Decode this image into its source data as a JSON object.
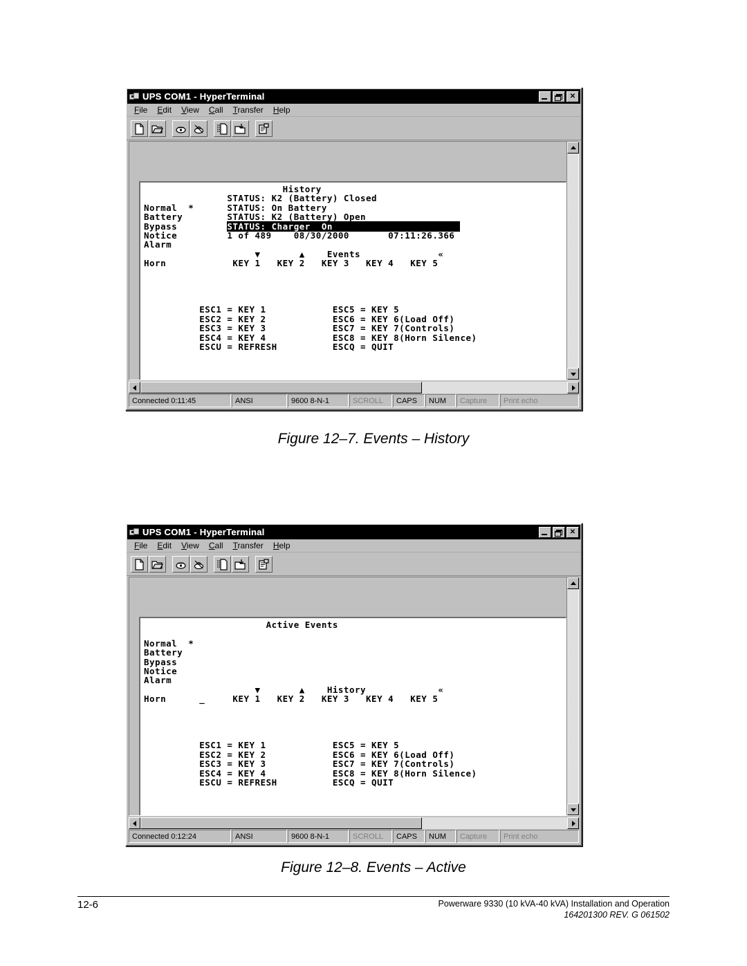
{
  "document": {
    "footer": {
      "page_number": "12-6",
      "product_line": "Powerware 9330 (10 kVA-40 kVA) Installation and Operation",
      "doc_ref": "164201300 REV. G  061502"
    },
    "captions": {
      "figure_12_7": "Figure 12–7. Events – History",
      "figure_12_8": "Figure 12–8. Events – Active"
    }
  },
  "window": {
    "title": "UPS COM1 - HyperTerminal",
    "title_icon": "hyperterminal-icon",
    "controls": {
      "minimize": "_",
      "restore": "❐",
      "close": "✕"
    },
    "menu": [
      {
        "label": "File",
        "accel": "F"
      },
      {
        "label": "Edit",
        "accel": "E"
      },
      {
        "label": "View",
        "accel": "V"
      },
      {
        "label": "Call",
        "accel": "C"
      },
      {
        "label": "Transfer",
        "accel": "T"
      },
      {
        "label": "Help",
        "accel": "H"
      }
    ],
    "toolbar": [
      {
        "name": "new-connection-icon",
        "group": 1
      },
      {
        "name": "open-file-icon",
        "group": 1
      },
      {
        "name": "call-icon",
        "group": 2
      },
      {
        "name": "disconnect-icon",
        "group": 2
      },
      {
        "name": "send-file-icon",
        "group": 3
      },
      {
        "name": "receive-file-icon",
        "group": 3
      },
      {
        "name": "properties-icon",
        "group": 4
      }
    ]
  },
  "terminal_1": {
    "screen_title": "History",
    "lines": [
      {
        "text": "                         History",
        "invert": false
      },
      {
        "text": "               STATUS: K2 (Battery) Closed",
        "invert": false
      },
      {
        "text": "Normal  *      STATUS: On Battery",
        "invert": false
      },
      {
        "text": "Battery        STATUS: K2 (Battery) Open",
        "invert": false
      },
      {
        "text": "Bypass         ",
        "invert": false,
        "highlight": "STATUS: Charger  On                       "
      },
      {
        "text": "Notice         1 of 489    08/30/2000       07:11:26.366",
        "invert": false
      },
      {
        "text": "Alarm",
        "invert": false
      },
      {
        "text": "                    ▼       ▲    Events              «",
        "invert": false
      },
      {
        "text": "Horn            KEY 1   KEY 2   KEY 3   KEY 4   KEY 5",
        "invert": false
      },
      {
        "text": "",
        "invert": false
      },
      {
        "text": "",
        "invert": false
      },
      {
        "text": "",
        "invert": false
      },
      {
        "text": "",
        "invert": false
      },
      {
        "text": "          ESC1 = KEY 1            ESC5 = KEY 5",
        "invert": false
      },
      {
        "text": "          ESC2 = KEY 2            ESC6 = KEY 6(Load Off)",
        "invert": false
      },
      {
        "text": "          ESC3 = KEY 3            ESC7 = KEY 7(Controls)",
        "invert": false
      },
      {
        "text": "          ESC4 = KEY 4            ESC8 = KEY 8(Horn Silence)",
        "invert": false
      },
      {
        "text": "          ESCU = REFRESH          ESCQ = QUIT",
        "invert": false
      }
    ],
    "status": {
      "connected": "Connected 0:11:45",
      "emulation": "ANSI",
      "line_settings": "9600 8-N-1",
      "scroll": "SCROLL",
      "caps": "CAPS",
      "num": "NUM",
      "capture": "Capture",
      "print_echo": "Print echo"
    }
  },
  "terminal_2": {
    "screen_title": "Active Events",
    "lines": [
      {
        "text": "                      Active Events",
        "invert": false
      },
      {
        "text": "",
        "invert": false
      },
      {
        "text": "Normal  *",
        "invert": false
      },
      {
        "text": "Battery",
        "invert": false
      },
      {
        "text": "Bypass",
        "invert": false
      },
      {
        "text": "Notice",
        "invert": false
      },
      {
        "text": "Alarm",
        "invert": false
      },
      {
        "text": "                    ▼       ▲    History             «",
        "invert": false
      },
      {
        "text": "Horn      _     KEY 1   KEY 2   KEY 3   KEY 4   KEY 5",
        "invert": false
      },
      {
        "text": "",
        "invert": false
      },
      {
        "text": "",
        "invert": false
      },
      {
        "text": "",
        "invert": false
      },
      {
        "text": "",
        "invert": false
      },
      {
        "text": "          ESC1 = KEY 1            ESC5 = KEY 5",
        "invert": false
      },
      {
        "text": "          ESC2 = KEY 2            ESC6 = KEY 6(Load Off)",
        "invert": false
      },
      {
        "text": "          ESC3 = KEY 3            ESC7 = KEY 7(Controls)",
        "invert": false
      },
      {
        "text": "          ESC4 = KEY 4            ESC8 = KEY 8(Horn Silence)",
        "invert": false
      },
      {
        "text": "          ESCU = REFRESH          ESCQ = QUIT",
        "invert": false
      }
    ],
    "status": {
      "connected": "Connected 0:12:24",
      "emulation": "ANSI",
      "line_settings": "9600 8-N-1",
      "scroll": "SCROLL",
      "caps": "CAPS",
      "num": "NUM",
      "capture": "Capture",
      "print_echo": "Print echo"
    }
  }
}
